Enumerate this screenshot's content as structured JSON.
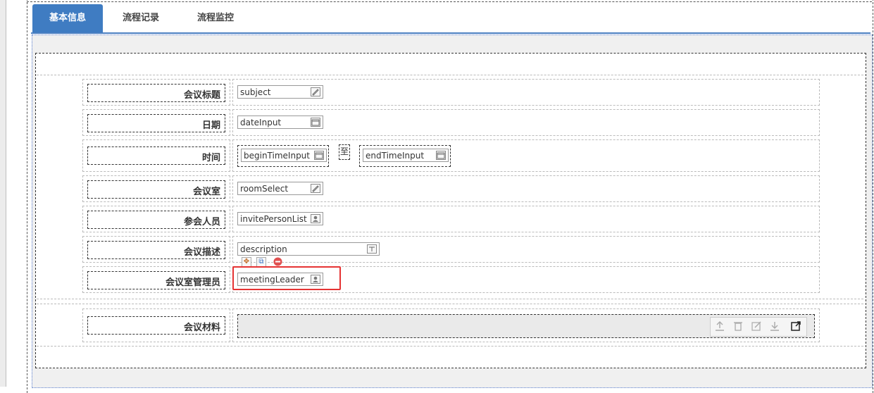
{
  "tabs": [
    {
      "label": "基本信息",
      "active": true
    },
    {
      "label": "流程记录",
      "active": false
    },
    {
      "label": "流程监控",
      "active": false
    }
  ],
  "form": {
    "subject": {
      "label": "会议标题",
      "value": "subject",
      "icon": "edit-icon"
    },
    "date": {
      "label": "日期",
      "value": "dateInput",
      "icon": "calendar-icon"
    },
    "time": {
      "label": "时间",
      "begin": "beginTimeInput",
      "separator": "至",
      "end": "endTimeInput",
      "icon": "calendar-icon"
    },
    "room": {
      "label": "会议室",
      "value": "roomSelect",
      "icon": "edit-icon"
    },
    "attendees": {
      "label": "参会人员",
      "value": "invitePersonList",
      "icon": "person-icon"
    },
    "description": {
      "label": "会议描述",
      "value": "description",
      "icon": "text-field-icon"
    },
    "manager": {
      "label": "会议室管理员",
      "value": "meetingLeader",
      "icon": "person-icon"
    },
    "materials": {
      "label": "会议材料"
    }
  },
  "element_toolbar": [
    "move-icon",
    "copy-icon",
    "delete-icon"
  ],
  "upload_tools": [
    "upload-icon",
    "trash-icon",
    "edit-icon",
    "download-icon",
    "open-external-icon"
  ],
  "colors": {
    "accent": "#3f7cc2",
    "highlight": "#e53333"
  }
}
